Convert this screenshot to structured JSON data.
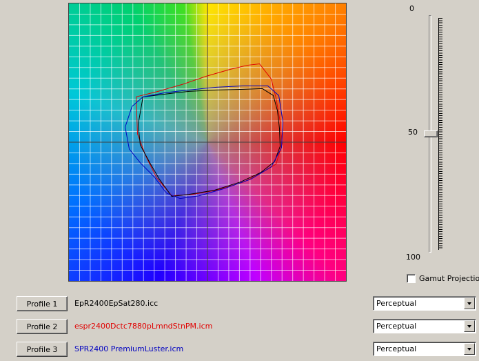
{
  "plot": {
    "gamut_colors": {
      "profile1": "#000000",
      "profile2": "#e00000",
      "profile3": "#0000c0"
    }
  },
  "lightness_slider": {
    "min_label": "0",
    "mid_label": "50",
    "max_label": "100",
    "value": 50
  },
  "gamut_projection": {
    "label": "Gamut Projection",
    "checked": false
  },
  "profiles": [
    {
      "button_label": "Profile 1",
      "name": "EpR2400EpSat280.icc",
      "color": "#000000",
      "intent": "Perceptual"
    },
    {
      "button_label": "Profile 2",
      "name": "espr2400Dctc7880pLmndStnPM.icm",
      "color": "#e00000",
      "intent": "Perceptual"
    },
    {
      "button_label": "Profile 3",
      "name": "SPR2400 PremiumLuster.icm",
      "color": "#0000c0",
      "intent": "Perceptual"
    }
  ]
}
